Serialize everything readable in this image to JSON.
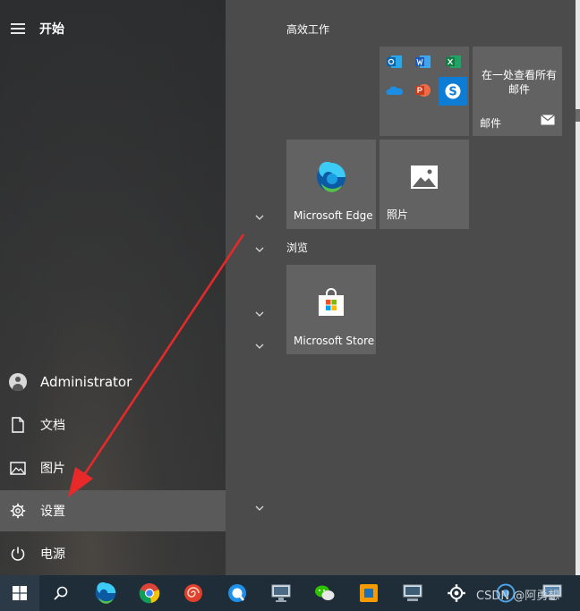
{
  "header": {
    "title": "开始"
  },
  "nav": {
    "user": "Administrator",
    "documents": "文档",
    "pictures": "图片",
    "settings": "设置",
    "power": "电源"
  },
  "groups": {
    "productivity": "高效工作",
    "browse": "浏览"
  },
  "tiles": {
    "mail_text": "在一处查看所有邮件",
    "mail": "邮件",
    "edge": "Microsoft Edge",
    "photos": "照片",
    "store": "Microsoft Store"
  },
  "taskbar": {
    "watermark": "CSDN @阿勇想"
  },
  "icons": {
    "menu": "hamburger-icon",
    "user": "user-avatar-icon",
    "documents": "document-icon",
    "pictures": "picture-icon",
    "settings": "gear-icon",
    "power": "power-icon"
  },
  "colors": {
    "left_pane": "#2f3031",
    "right_pane": "#4b4b4b",
    "tile": "#626262",
    "selected_item": "#5a5a5a",
    "taskbar": "#1f2d38",
    "arrow": "#e8292a"
  }
}
